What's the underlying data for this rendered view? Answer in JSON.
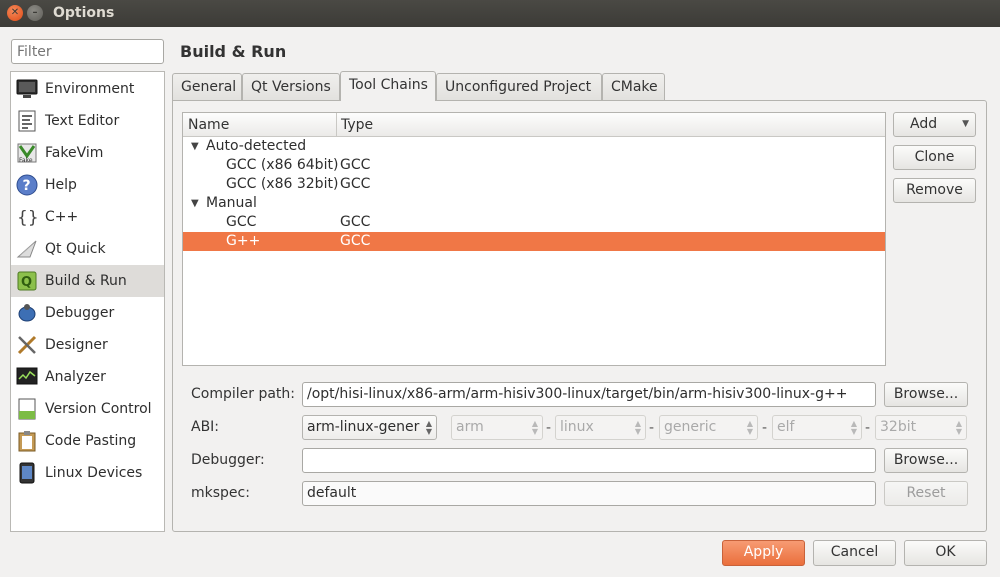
{
  "window": {
    "title": "Options"
  },
  "filter": {
    "placeholder": "Filter"
  },
  "sidebar": {
    "items": [
      {
        "label": "Environment",
        "icon": "monitor-icon"
      },
      {
        "label": "Text Editor",
        "icon": "text-document-icon"
      },
      {
        "label": "FakeVim",
        "icon": "fakevim-icon"
      },
      {
        "label": "Help",
        "icon": "help-icon"
      },
      {
        "label": "C++",
        "icon": "braces-icon"
      },
      {
        "label": "Qt Quick",
        "icon": "qt-quick-icon"
      },
      {
        "label": "Build & Run",
        "icon": "build-run-icon",
        "active": true
      },
      {
        "label": "Debugger",
        "icon": "debugger-icon"
      },
      {
        "label": "Designer",
        "icon": "designer-icon"
      },
      {
        "label": "Analyzer",
        "icon": "analyzer-icon"
      },
      {
        "label": "Version Control",
        "icon": "version-control-icon"
      },
      {
        "label": "Code Pasting",
        "icon": "clipboard-icon"
      },
      {
        "label": "Linux Devices",
        "icon": "device-icon"
      }
    ]
  },
  "page": {
    "title": "Build & Run"
  },
  "tabs": [
    {
      "label": "General"
    },
    {
      "label": "Qt Versions"
    },
    {
      "label": "Tool Chains",
      "active": true
    },
    {
      "label": "Unconfigured Project"
    },
    {
      "label": "CMake"
    }
  ],
  "toolchains": {
    "columns": {
      "name": "Name",
      "type": "Type"
    },
    "groups": [
      {
        "label": "Auto-detected",
        "rows": [
          {
            "name": "GCC (x86 64bit)",
            "type": "GCC"
          },
          {
            "name": "GCC (x86 32bit)",
            "type": "GCC"
          }
        ]
      },
      {
        "label": "Manual",
        "rows": [
          {
            "name": "GCC",
            "type": "GCC"
          },
          {
            "name": "G++",
            "type": "GCC",
            "selected": true
          }
        ]
      }
    ],
    "selection_color": "#f07746"
  },
  "buttons": {
    "add": "Add",
    "clone": "Clone",
    "remove": "Remove"
  },
  "form": {
    "compiler_path_label": "Compiler path:",
    "compiler_path_value": "/opt/hisi-linux/x86-arm/arm-hisiv300-linux/target/bin/arm-hisiv300-linux-g++",
    "browse_label": "Browse...",
    "abi_label": "ABI:",
    "abi_selected": "arm-linux-gener",
    "abi_parts": [
      "arm",
      "linux",
      "generic",
      "elf",
      "32bit"
    ],
    "debugger_label": "Debugger:",
    "debugger_value": "",
    "debugger_browse_label": "Browse...",
    "mkspec_label": "mkspec:",
    "mkspec_value": "default",
    "reset_label": "Reset"
  },
  "dialog_buttons": {
    "apply": "Apply",
    "cancel": "Cancel",
    "ok": "OK"
  },
  "colors": {
    "accent": "#f07746",
    "titlebar": "#3c3b37"
  }
}
